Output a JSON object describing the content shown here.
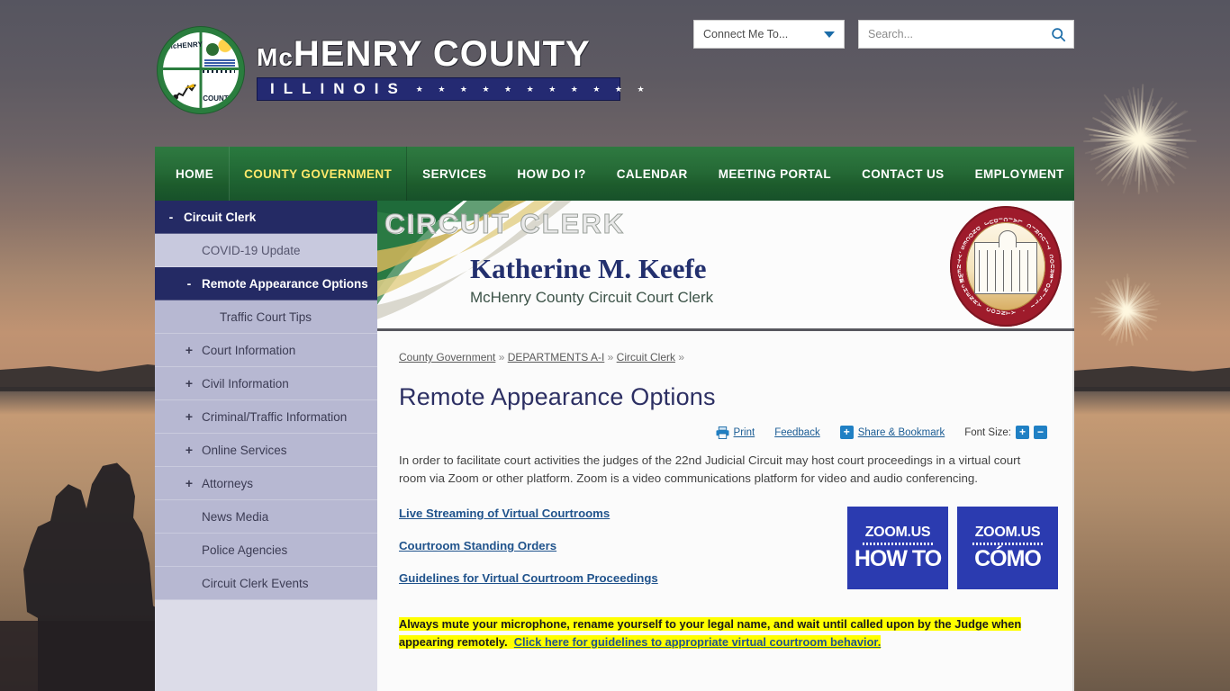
{
  "header": {
    "logo_alt": "McHenry County seal",
    "wordmark_mc": "Mc",
    "wordmark_rest": "HENRY COUNTY",
    "wordmark_state": "ILLINOIS",
    "stars": "★ ★ ★ ★ ★ ★ ★ ★ ★ ★ ★",
    "seal_mchenry": "McHENRY",
    "seal_county": "COUNTY"
  },
  "connect": {
    "label": "Connect Me To...",
    "caret_icon": "chevron-down-icon"
  },
  "search": {
    "placeholder": "Search...",
    "value": "",
    "icon": "search-icon"
  },
  "nav": {
    "items": [
      {
        "label": "HOME",
        "active": false
      },
      {
        "label": "COUNTY GOVERNMENT",
        "active": true
      },
      {
        "label": "SERVICES",
        "active": false
      },
      {
        "label": "HOW DO I?",
        "active": false
      },
      {
        "label": "CALENDAR",
        "active": false
      },
      {
        "label": "MEETING PORTAL",
        "active": false
      },
      {
        "label": "CONTACT US",
        "active": false
      },
      {
        "label": "EMPLOYMENT",
        "active": false
      }
    ]
  },
  "sidebar": {
    "items": [
      {
        "label": "Circuit Clerk",
        "sign": "-",
        "level": 0,
        "style": "dark"
      },
      {
        "label": "COVID-19 Update",
        "sign": "",
        "level": 1,
        "style": "light"
      },
      {
        "label": "Remote Appearance Options",
        "sign": "-",
        "level": 1,
        "style": "dark"
      },
      {
        "label": "Traffic Court Tips",
        "sign": "",
        "level": 2,
        "style": "plain"
      },
      {
        "label": "Court Information",
        "sign": "+",
        "level": 1,
        "style": "plain"
      },
      {
        "label": "Civil Information",
        "sign": "+",
        "level": 1,
        "style": "plain"
      },
      {
        "label": "Criminal/Traffic Information",
        "sign": "+",
        "level": 1,
        "style": "plain"
      },
      {
        "label": "Online Services",
        "sign": "+",
        "level": 1,
        "style": "plain"
      },
      {
        "label": "Attorneys",
        "sign": "+",
        "level": 1,
        "style": "plain"
      },
      {
        "label": "News Media",
        "sign": "",
        "level": 1,
        "style": "plain"
      },
      {
        "label": "Police Agencies",
        "sign": "",
        "level": 1,
        "style": "plain"
      },
      {
        "label": "Circuit Clerk Events",
        "sign": "",
        "level": 1,
        "style": "plain"
      }
    ]
  },
  "banner": {
    "title": "CIRCUIT CLERK",
    "name": "Katherine M. Keefe",
    "subtitle": "McHenry County Circuit Court Clerk",
    "seal_top_text": "TWENTY-SECOND JUDICIAL CIRCUIT COURT",
    "seal_bottom_text": "McHENRY COUNTY · ILLINOIS"
  },
  "breadcrumb": {
    "items": [
      "County Government",
      "DEPARTMENTS A-I",
      "Circuit Clerk"
    ],
    "separator": "»"
  },
  "page": {
    "title": "Remote Appearance Options",
    "paragraph": "In order to facilitate court activities the judges of the 22nd Judicial Circuit may host court proceedings in a virtual court room via Zoom or other platform.  Zoom is a video communications platform for video and audio conferencing."
  },
  "toolbar": {
    "print_label": "Print",
    "print_icon": "printer-icon",
    "feedback_label": "Feedback",
    "share_label": "Share & Bookmark",
    "share_icon": "plus-square-icon",
    "font_size_label": "Font Size:",
    "font_increase": "+",
    "font_decrease": "−"
  },
  "links": [
    {
      "label": "Live Streaming of Virtual Courtrooms"
    },
    {
      "label": "Courtroom Standing Orders "
    },
    {
      "label": "Guidelines for Virtual Courtroom Proceedings"
    }
  ],
  "zoom_cards": [
    {
      "top": "ZOOM.US",
      "bottom": "HOW TO"
    },
    {
      "top": "ZOOM.US",
      "bottom": "CÓMO"
    }
  ],
  "notice": {
    "highlight": "Always mute your microphone, rename yourself to your legal name, and wait until called upon by the Judge when appearing remotely.",
    "link": "Click here for guidelines to appropriate virtual courtroom behavior."
  },
  "colors": {
    "nav_green": "#256a36",
    "nav_active_text": "#ffe96b",
    "sidebar_dark": "#242a64",
    "sidebar_light": "#c8c9de",
    "sidebar_plain": "#b7b8d2",
    "link_blue": "#20538c",
    "highlight_yellow": "#ffff00",
    "title_navy": "#2c2f63",
    "zoom_blue": "#2b3bb0",
    "toolbar_blue": "#2080c4"
  }
}
